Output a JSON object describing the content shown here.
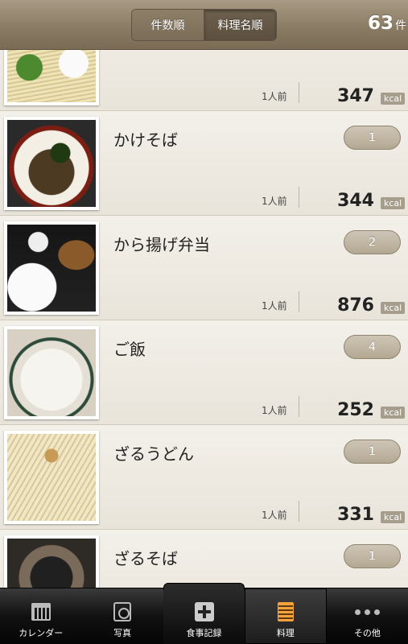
{
  "header": {
    "sort_by_count": "件数順",
    "sort_by_name": "料理名順",
    "count": "63",
    "count_unit": "件"
  },
  "rows": [
    {
      "name": "",
      "count": "",
      "serving": "1人前",
      "kcal": "347",
      "kcal_unit": "kcal",
      "image": "udon-photo"
    },
    {
      "name": "かけそば",
      "count": "1",
      "serving": "1人前",
      "kcal": "344",
      "kcal_unit": "kcal",
      "image": "kake-soba-photo"
    },
    {
      "name": "から揚げ弁当",
      "count": "2",
      "serving": "1人前",
      "kcal": "876",
      "kcal_unit": "kcal",
      "image": "karaage-bento-photo"
    },
    {
      "name": "ご飯",
      "count": "4",
      "serving": "1人前",
      "kcal": "252",
      "kcal_unit": "kcal",
      "image": "rice-photo"
    },
    {
      "name": "ざるうどん",
      "count": "1",
      "serving": "1人前",
      "kcal": "331",
      "kcal_unit": "kcal",
      "image": "zaru-udon-photo"
    },
    {
      "name": "ざるそば",
      "count": "1",
      "serving": "",
      "kcal": "",
      "kcal_unit": "",
      "image": "zaru-soba-photo"
    }
  ],
  "tabbar": {
    "calendar": "カレンダー",
    "photo": "写真",
    "meal_record": "食事記録",
    "dishes": "料理",
    "other": "その他"
  },
  "colors": {
    "header_bg": "#8b7c65",
    "list_bg": "#efebe3",
    "badge_bg": "#b3a892",
    "tab_active_icon": "#f7a23b"
  }
}
